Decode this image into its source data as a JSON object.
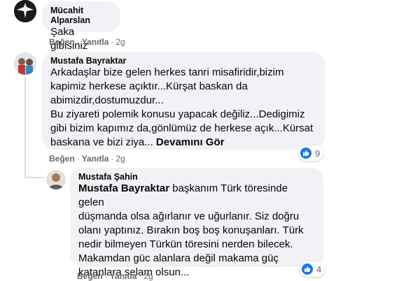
{
  "comments": [
    {
      "author": "Mücahit Alparslan",
      "text": "Şaka gibisiniz",
      "actions": {
        "like": "Beğen",
        "reply": "Yanıtla",
        "time": "2g"
      }
    },
    {
      "author": "Mustafa Bayraktar",
      "text": "Arkadaşlar bize gelen herkes tanri misafiridir,bizim\nkapimiz herkese açıktır...Kürşat baskan da\nabimizdir,dostumuzdur...\nBu ziyareti polemik konusu yapacak değiliz...Dedigimiz\ngibi bizim kapımız da,gönlümüz de herkese açık...Kürsat\nbaskana ve bizi ziya...",
      "see_more": "Devamını Gör",
      "reaction_count": "9",
      "actions": {
        "like": "Beğen",
        "reply": "Yanıtla",
        "time": "2g"
      }
    },
    {
      "author": "Mustafa Şahin",
      "mention": "Mustafa Bayraktar",
      "text": " başkanım Türk töresinde gelen\ndüşmanda olsa ağırlanır ve uğurlanır. Siz doğru\nolanı yaptınız. Bırakın boş boş konuşanları. Türk\nnedir bilmeyen Türkün töresini nerden bilecek.\nMakamdan güc alanlara değil makama güç\nkatanlara selam olsun...",
      "reaction_count": "4",
      "actions": {
        "like": "Beğen",
        "reply": "Yanıtla",
        "time": "2g"
      }
    }
  ],
  "colors": {
    "bubble": "#f0f2f5",
    "meta": "#65676b",
    "like_blue": "#1877f2"
  }
}
